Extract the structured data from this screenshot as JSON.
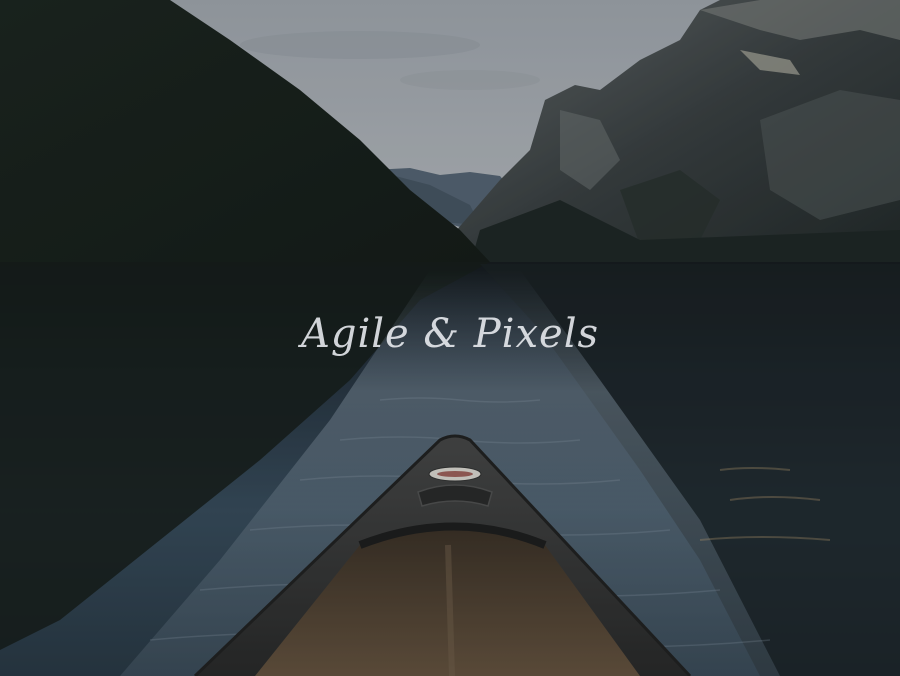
{
  "hero": {
    "brand_title": "Agile & Pixels",
    "canoe_sticker_icon": "oval-sticker-icon"
  },
  "colors": {
    "sky": "#b9bec6",
    "mountain_dark": "#1d2a22",
    "cliff": "#4a5052",
    "water": "#2d3b47",
    "canoe_hull": "#3a3a3a",
    "canoe_interior": "#5b4a38",
    "text": "#eceef2"
  }
}
